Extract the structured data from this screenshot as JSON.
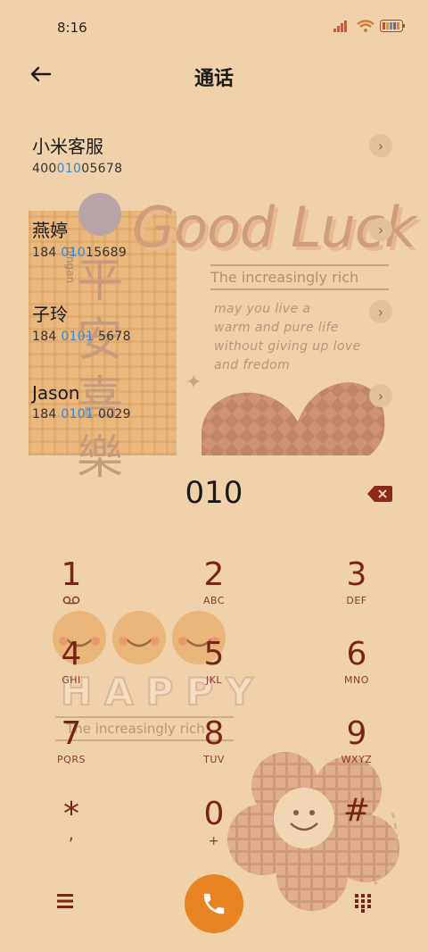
{
  "status": {
    "time": "8:16",
    "signal_icon": "signal-icon",
    "wifi_icon": "wifi-icon",
    "battery_icon": "battery-icon"
  },
  "header": {
    "title": "通话",
    "back_icon": "back-arrow-icon"
  },
  "decor": {
    "good_luck": "Good Luck",
    "rich_top": "The increasingly  rich",
    "poem": [
      "may you live a",
      "warm and pure life",
      "without giving up love",
      "and fredom"
    ],
    "cjk": "平安喜樂",
    "pingan": "pingan",
    "happy": "HAPPY",
    "rich_bottom": "The increasingly  rich"
  },
  "contacts": [
    {
      "name": "小米客服",
      "num_pre": "400",
      "num_hl": "010",
      "num_post": "05678"
    },
    {
      "name": "燕婷",
      "num_pre": "184 ",
      "num_hl": "010",
      "num_post": "15689"
    },
    {
      "name": "子玲",
      "num_pre": "184 ",
      "num_hl": "0101",
      "num_post": " 5678"
    },
    {
      "name": "Jason",
      "num_pre": "184 ",
      "num_hl": "0101",
      "num_post": " 0029"
    }
  ],
  "dialer": {
    "typed": "010",
    "keys": [
      {
        "n": "1",
        "l": "voicemail"
      },
      {
        "n": "2",
        "l": "ABC"
      },
      {
        "n": "3",
        "l": "DEF"
      },
      {
        "n": "4",
        "l": "GHI"
      },
      {
        "n": "5",
        "l": "JKL"
      },
      {
        "n": "6",
        "l": "MNO"
      },
      {
        "n": "7",
        "l": "PQRS"
      },
      {
        "n": "8",
        "l": "TUV"
      },
      {
        "n": "9",
        "l": "WXYZ"
      },
      {
        "n": "*",
        "l": ","
      },
      {
        "n": "0",
        "l": "+"
      },
      {
        "n": "#",
        "l": ""
      }
    ]
  },
  "colors": {
    "bg": "#f0d2aa",
    "accent": "#e88422",
    "key": "#7a2418",
    "highlight": "#2e8ad8"
  }
}
